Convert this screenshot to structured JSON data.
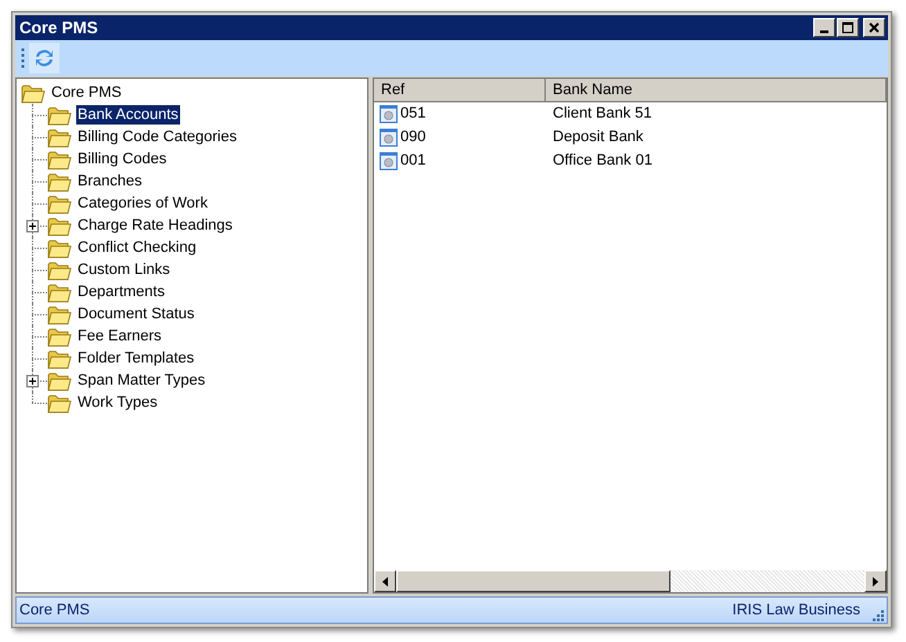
{
  "window": {
    "title": "Core PMS"
  },
  "tree": {
    "label": "Core PMS",
    "children": [
      {
        "label": "Bank Accounts",
        "selected": true,
        "expandable": false
      },
      {
        "label": "Billing Code Categories",
        "selected": false,
        "expandable": false
      },
      {
        "label": "Billing Codes",
        "selected": false,
        "expandable": false
      },
      {
        "label": "Branches",
        "selected": false,
        "expandable": false
      },
      {
        "label": "Categories of Work",
        "selected": false,
        "expandable": false
      },
      {
        "label": "Charge Rate Headings",
        "selected": false,
        "expandable": true
      },
      {
        "label": "Conflict Checking",
        "selected": false,
        "expandable": false
      },
      {
        "label": "Custom Links",
        "selected": false,
        "expandable": false
      },
      {
        "label": "Departments",
        "selected": false,
        "expandable": false
      },
      {
        "label": "Document Status",
        "selected": false,
        "expandable": false
      },
      {
        "label": "Fee Earners",
        "selected": false,
        "expandable": false
      },
      {
        "label": "Folder Templates",
        "selected": false,
        "expandable": false
      },
      {
        "label": "Span Matter Types",
        "selected": false,
        "expandable": true
      },
      {
        "label": "Work Types",
        "selected": false,
        "expandable": false
      }
    ]
  },
  "table": {
    "columns": [
      "Ref",
      "Bank Name"
    ],
    "rows": [
      [
        "051",
        "Client Bank 51"
      ],
      [
        "090",
        "Deposit Bank"
      ],
      [
        "001",
        "Office Bank 01"
      ]
    ]
  },
  "status_bar": {
    "left": "Core PMS",
    "right": "IRIS Law Business"
  }
}
